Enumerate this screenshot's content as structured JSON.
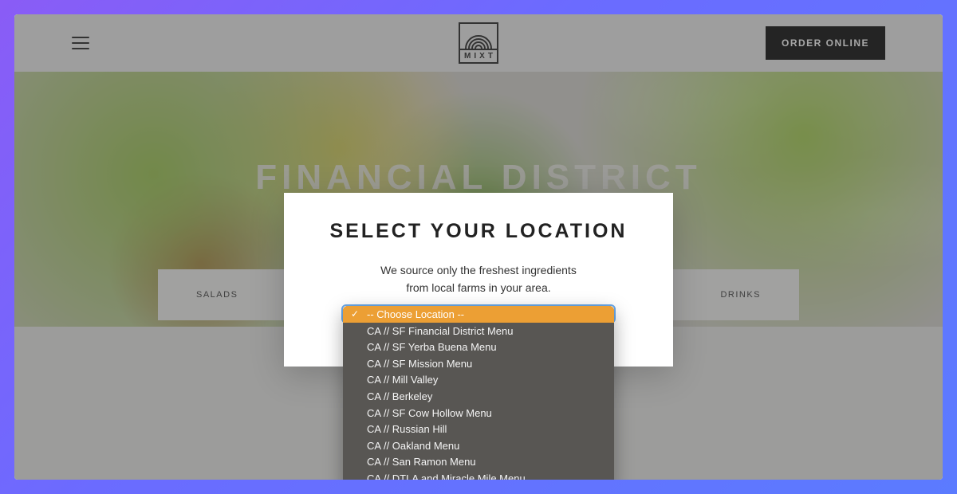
{
  "header": {
    "brand": "MIXT",
    "order_label": "ORDER ONLINE"
  },
  "hero": {
    "title": "FINANCIAL DISTRICT"
  },
  "categories": {
    "left": "SALADS",
    "right": "DRINKS"
  },
  "modal": {
    "title": "SELECT YOUR LOCATION",
    "line1": "We source only the freshest ingredients",
    "line2": "from local farms in your area."
  },
  "dropdown": {
    "placeholder": "-- Choose Location --",
    "options": [
      "CA // SF Financial District Menu",
      "CA // SF Yerba Buena Menu",
      "CA // SF Mission Menu",
      "CA // Mill Valley",
      "CA // Berkeley",
      "CA // SF Cow Hollow Menu",
      "CA // Russian Hill",
      "CA // Oakland Menu",
      "CA // San Ramon Menu",
      "CA // DTLA and Miracle Mile Menu"
    ]
  }
}
